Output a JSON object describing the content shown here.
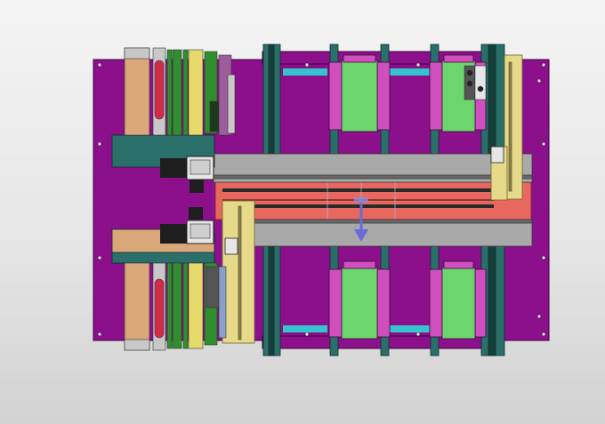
{
  "colors": {
    "frame": "#8c0f8c",
    "frame_dark": "#5a085a",
    "rail": "#2b6f6a",
    "rail_dark": "#163f3c",
    "carriage_pink": "#d04fbf",
    "carriage_green": "#6cd66c",
    "beam_grey": "#a9a9a9",
    "beam_dark": "#6a6a6a",
    "tan": "#d9a77a",
    "yellow_rail": "#e6d98a",
    "red_belt": "#e8685f",
    "cyan_rod": "#35c4cf",
    "roller_tan": "#d9a77a",
    "roller_red": "#d42a4a",
    "roller_green": "#2f8f2f",
    "roller_yellow": "#e6da6a",
    "arrow": "#6a6ad8"
  },
  "view": {
    "icon": "cad-assembly-top-view",
    "components": [
      "base-frame",
      "linear-rails",
      "carriages",
      "gantry-beams",
      "roller-stack",
      "motors",
      "belt-track",
      "z-axis-arrow"
    ]
  }
}
